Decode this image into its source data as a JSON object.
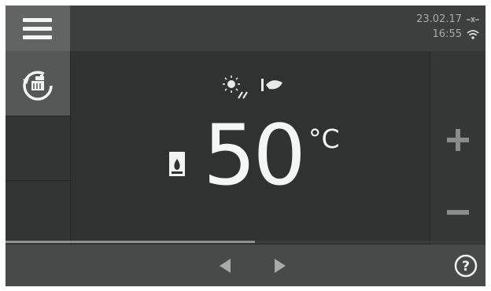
{
  "status": {
    "date": "23.02.17",
    "time": "16:55",
    "icons": [
      "disconnected-icon",
      "wifi-icon"
    ]
  },
  "header": {
    "menu_icon": "hamburger-menu-icon"
  },
  "sidebar": {
    "mode_button_icon": "hot-water-tap-refresh-icon"
  },
  "main": {
    "mode_icons": [
      "sun-icon",
      "eco-leaf-icon"
    ],
    "burner_icon": "boiler-flame-icon",
    "temperature": "50",
    "unit": "°C"
  },
  "controls": {
    "increase_icon": "plus-icon",
    "decrease_icon": "minus-icon"
  },
  "footer": {
    "prev_icon": "arrow-left-icon",
    "next_icon": "arrow-right-icon",
    "help_icon": "help-icon",
    "help_label": "?",
    "progress": 0.52
  },
  "colors": {
    "screen_bg": "#2f3231",
    "menu_bg": "#626464",
    "text": "#f5f5f5",
    "muted": "#a8aaaa"
  }
}
